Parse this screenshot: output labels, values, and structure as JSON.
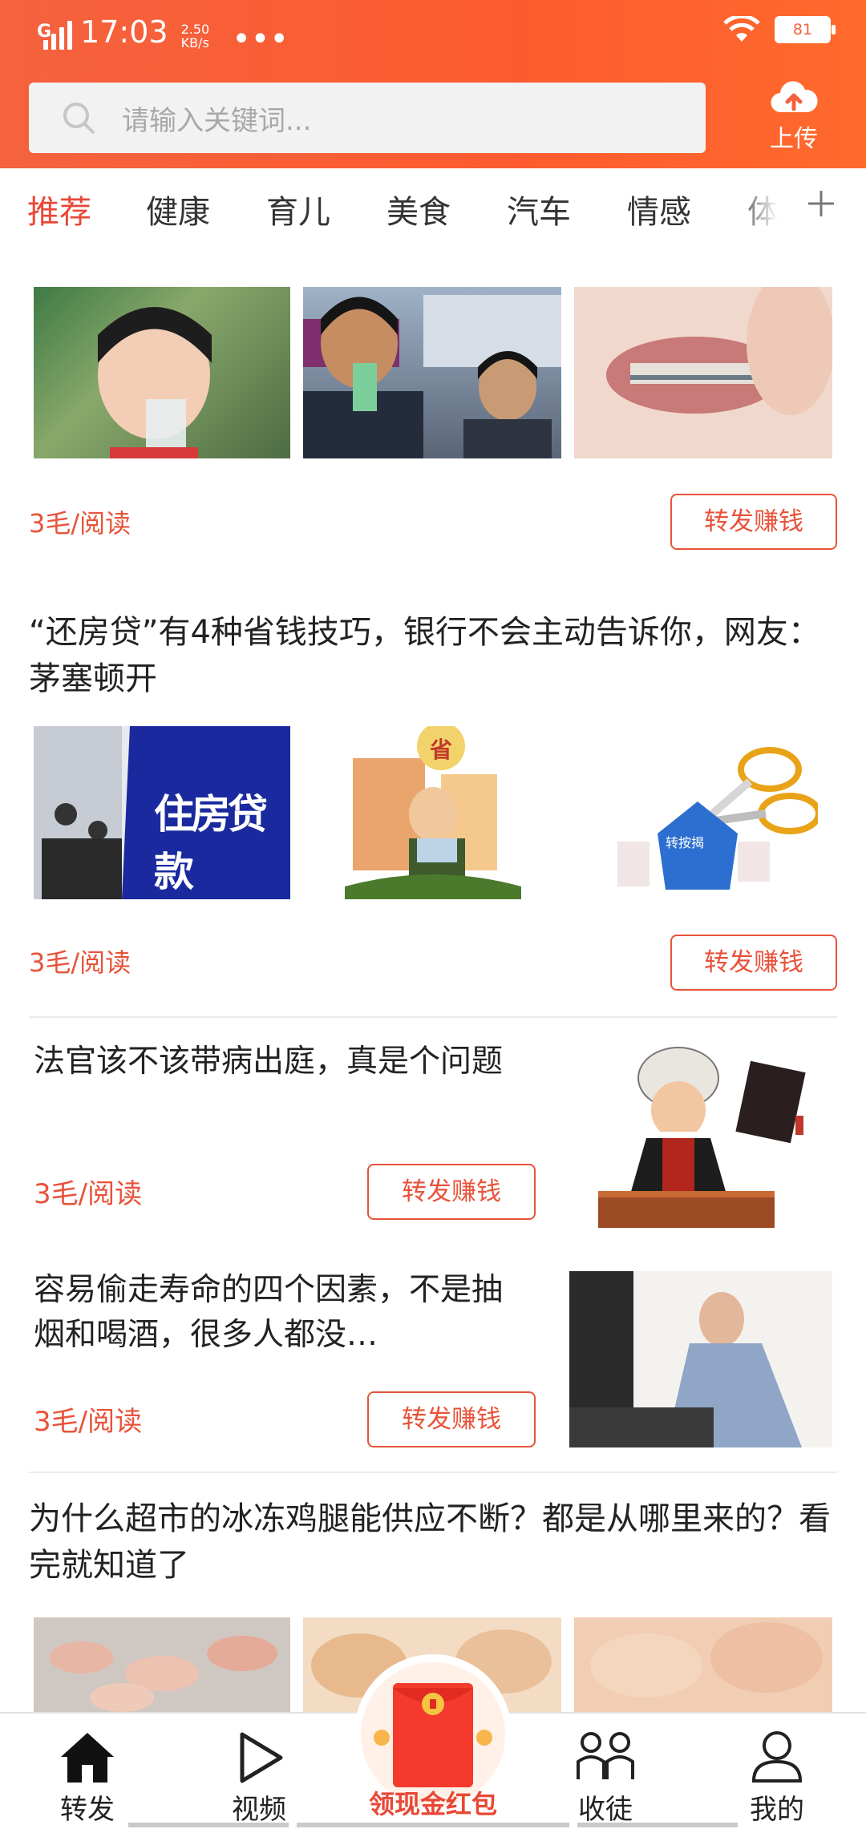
{
  "status_bar": {
    "network": "G",
    "time": "17:03",
    "speed_value": "2.50",
    "speed_unit": "KB/s",
    "more": "•••",
    "battery": "81"
  },
  "search": {
    "placeholder": "请输入关键词..."
  },
  "upload": {
    "label": "上传",
    "icon": "cloud-upload-icon"
  },
  "tabs": [
    "推荐",
    "健康",
    "育儿",
    "美食",
    "汽车",
    "情感",
    "体"
  ],
  "feed": {
    "card1": {
      "reward": "3毛/阅读",
      "share_label": "转发赚钱"
    },
    "card2": {
      "title": "“还房贷”有4种省钱技巧，银行不会主动告诉你，网友：茅塞顿开",
      "reward": "3毛/阅读",
      "share_label": "转发赚钱",
      "banner_text": "住房贷款",
      "house_text": "转按揭",
      "sign_text": "省"
    },
    "card3": {
      "title": "法官该不该带病出庭，真是个问题",
      "reward": "3毛/阅读",
      "share_label": "转发赚钱"
    },
    "card4": {
      "title": "容易偷走寿命的四个因素，不是抽烟和喝酒，很多人都没…",
      "reward": "3毛/阅读",
      "share_label": "转发赚钱"
    },
    "card5": {
      "title": "为什么超市的冰冻鸡腿能供应不断？都是从哪里来的？看完就知道了"
    }
  },
  "bottom_nav": {
    "share": "转发",
    "video": "视频",
    "red_packet": "领现金红包",
    "income": "收徒",
    "mine": "我的"
  },
  "colors": {
    "brand": "#f4623e",
    "accent_red": "#e8533a"
  }
}
